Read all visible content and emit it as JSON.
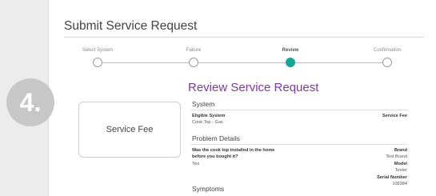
{
  "page": {
    "title": "Submit Service Request",
    "badge": "4."
  },
  "steps": [
    {
      "label": "Select System",
      "state": "done"
    },
    {
      "label": "Failure",
      "state": "done"
    },
    {
      "label": "Review",
      "state": "active"
    },
    {
      "label": "Confirmation",
      "state": "pending"
    }
  ],
  "colors": {
    "accent": "#1aa59a",
    "title_purple": "#7b3a9c",
    "badge_gray": "#c7c7c7"
  },
  "fee_card": {
    "label": "Service Fee"
  },
  "review": {
    "title": "Review Service Request",
    "system": {
      "heading": "System",
      "eligible_label": "Eligible System",
      "eligible_value": "Cook Top - Gas",
      "fee_label": "Service Fee"
    },
    "problem": {
      "heading": "Problem Details",
      "question_line1": "Was the cook top installed in the home",
      "question_line2": "before you bought it?",
      "answer": "Yes",
      "brand_label": "Brand",
      "brand_value": "Test Brand",
      "model_label": "Model",
      "model_value": "Tester",
      "serial_label": "Serial Number",
      "serial_value": "109384"
    },
    "symptoms": {
      "heading": "Symptoms"
    }
  }
}
